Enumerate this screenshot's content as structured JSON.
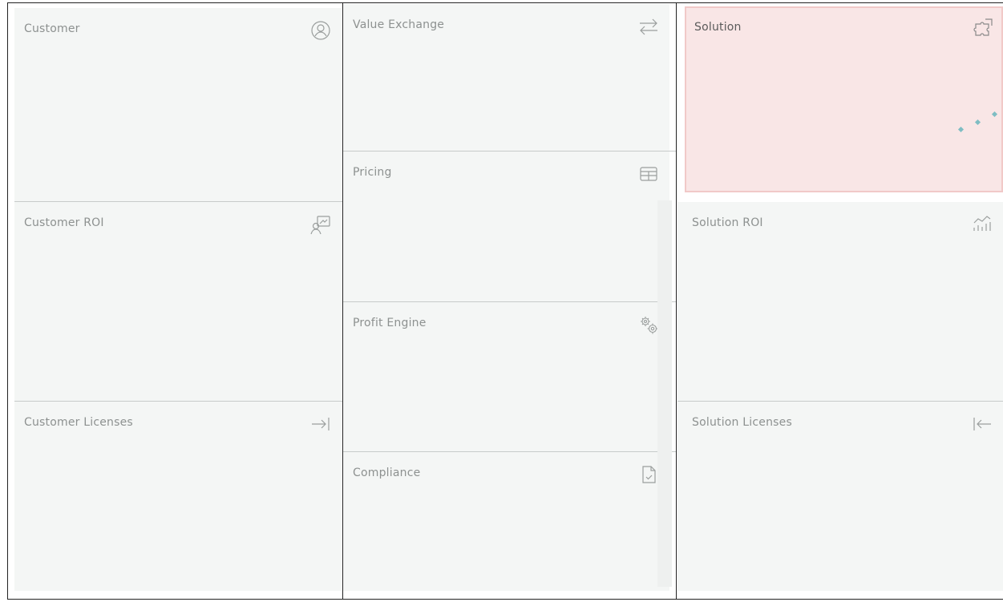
{
  "canvas": {
    "customer": {
      "title": "Customer",
      "icon": "user-circle-icon"
    },
    "customer_roi": {
      "title": "Customer ROI",
      "icon": "user-chart-icon"
    },
    "customer_licenses": {
      "title": "Customer Licenses",
      "icon": "arrow-right-to-bar-icon"
    },
    "value_exchange": {
      "title": "Value Exchange",
      "icon": "arrows-exchange-icon"
    },
    "pricing": {
      "title": "Pricing",
      "icon": "table-icon"
    },
    "profit_engine": {
      "title": "Profit Engine",
      "icon": "gears-icon"
    },
    "compliance": {
      "title": "Compliance",
      "icon": "document-check-icon"
    },
    "solution": {
      "title": "Solution",
      "icon": "puzzle-icon"
    },
    "solution_roi": {
      "title": "Solution ROI",
      "icon": "bar-chart-trend-icon"
    },
    "solution_licenses": {
      "title": "Solution Licenses",
      "icon": "arrow-left-from-bar-icon"
    }
  },
  "colors": {
    "cell_bg": "#f4f6f5",
    "highlight_bg": "#f9e6e6",
    "highlight_border": "#f1c9c8",
    "label": "#8d9190",
    "dots": "#7fbdc3"
  }
}
